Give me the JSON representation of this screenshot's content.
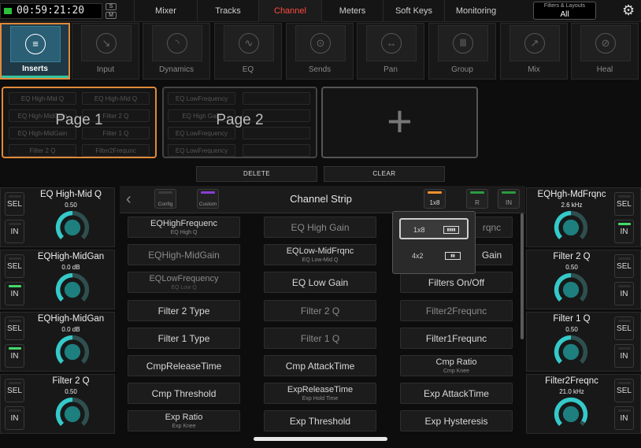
{
  "topbar": {
    "clock": "00:59:21:20",
    "small_buttons": [
      "S",
      "M"
    ],
    "tabs": [
      "Mixer",
      "Tracks",
      "Channel",
      "Meters",
      "Soft Keys",
      "Monitoring"
    ],
    "active_tab": "Channel",
    "filters_title": "Filters & Layouts",
    "filters_value": "All",
    "settings_icon": "gear-icon"
  },
  "categories": [
    {
      "label": "Inserts",
      "icon": "list-icon",
      "glyph": "≡"
    },
    {
      "label": "Input",
      "icon": "input-icon",
      "glyph": "↘"
    },
    {
      "label": "Dynamics",
      "icon": "dynamics-icon",
      "glyph": "◝"
    },
    {
      "label": "EQ",
      "icon": "eq-icon",
      "glyph": "∿"
    },
    {
      "label": "Sends",
      "icon": "sends-icon",
      "glyph": "⊙"
    },
    {
      "label": "Pan",
      "icon": "pan-icon",
      "glyph": "↔"
    },
    {
      "label": "Group",
      "icon": "group-icon",
      "glyph": "Ⅲ"
    },
    {
      "label": "Mix",
      "icon": "mix-icon",
      "glyph": "↗"
    },
    {
      "label": "Heal",
      "icon": "heal-icon",
      "glyph": "⊘"
    }
  ],
  "pages": [
    {
      "title": "Page 1",
      "cells": [
        "EQ High-Mid Q",
        "EQ High-Mid Q",
        "EQ High-MidGain",
        "Filter 2 Q",
        "EQ High-MidGain",
        "Filter 1 Q",
        "Filter 2 Q",
        "Filter2Frequnc"
      ]
    },
    {
      "title": "Page 2",
      "cells": [
        "EQ LowFrequency",
        "",
        "EQ High Gain",
        "",
        "EQ LowFrequency",
        "",
        "EQ LowFrequency",
        ""
      ]
    }
  ],
  "add_page_glyph": "+",
  "actions": {
    "delete": "DELETE",
    "clear": "CLEAR"
  },
  "strip_buttons": {
    "sel": "SEL",
    "in": "IN"
  },
  "left_strips": [
    {
      "name": "EQ High-Mid Q",
      "value": "0.50",
      "level": 0.5,
      "in_on": false
    },
    {
      "name": "EQHigh-MidGan",
      "value": "0.0 dB",
      "level": 0.5,
      "in_on": true
    },
    {
      "name": "EQHigh-MidGan",
      "value": "0.0 dB",
      "level": 0.5,
      "in_on": true
    },
    {
      "name": "Filter 2 Q",
      "value": "0.50",
      "level": 0.5,
      "in_on": false
    }
  ],
  "right_strips": [
    {
      "name": "EQHgh-MdFrqnc",
      "value": "2.6 kHz",
      "level": 0.5,
      "in_on": true
    },
    {
      "name": "Filter 2 Q",
      "value": "0.50",
      "level": 0.5,
      "in_on": false
    },
    {
      "name": "Filter 1 Q",
      "value": "0.50",
      "level": 0.5,
      "in_on": false
    },
    {
      "name": "Filter2Freqnc",
      "value": "21.0 kHz",
      "level": 0.95,
      "in_on": false
    }
  ],
  "channel_strip": {
    "title": "Channel Strip",
    "back_glyph": "‹",
    "icons": [
      {
        "label": "Config",
        "led": "#3a3a3a"
      },
      {
        "label": "Custom",
        "led": "#8a3fd1"
      },
      {
        "label": "1x8",
        "led": "#f0922b"
      },
      {
        "label": "R",
        "led": "#2c9b3f"
      },
      {
        "label": "IN",
        "led": "#2c9b3f"
      }
    ]
  },
  "params": {
    "col1": [
      {
        "main": "EQHighFrequenc",
        "sub": "EQ High Q",
        "dim": false
      },
      {
        "main": "EQHigh-MidGain",
        "sub": "",
        "dim": true
      },
      {
        "main": "EQLowFrequency",
        "sub": "EQ Low Q",
        "dim": true
      },
      {
        "main": "Filter 2 Type",
        "sub": "",
        "dim": false
      },
      {
        "main": "Filter 1 Type",
        "sub": "",
        "dim": false
      },
      {
        "main": "CmpReleaseTime",
        "sub": "",
        "dim": false
      },
      {
        "main": "Cmp Threshold",
        "sub": "",
        "dim": false
      },
      {
        "main": "Exp Ratio",
        "sub": "Exp Knee",
        "dim": false
      }
    ],
    "col2": [
      {
        "main": "EQ High Gain",
        "sub": "",
        "dim": true
      },
      {
        "main": "EQLow-MidFrqnc",
        "sub": "EQ Low-Mid Q",
        "dim": false
      },
      {
        "main": "EQ Low Gain",
        "sub": "",
        "dim": false
      },
      {
        "main": "Filter 2 Q",
        "sub": "",
        "dim": true
      },
      {
        "main": "Filter 1 Q",
        "sub": "",
        "dim": true
      },
      {
        "main": "Cmp AttackTime",
        "sub": "",
        "dim": false
      },
      {
        "main": "ExpReleaseTime",
        "sub": "Exp Hold Time",
        "dim": false
      },
      {
        "main": "Exp Threshold",
        "sub": "",
        "dim": false
      }
    ],
    "col3": [
      {
        "main": "rqnc",
        "sub": "",
        "dim": true
      },
      {
        "main": "Gain",
        "sub": "",
        "dim": false
      },
      {
        "main": "Filters On/Off",
        "sub": "",
        "dim": false
      },
      {
        "main": "Filter2Frequnc",
        "sub": "",
        "dim": true
      },
      {
        "main": "Filter1Frequnc",
        "sub": "",
        "dim": false
      },
      {
        "main": "Cmp Ratio",
        "sub": "Cmp Knee",
        "dim": false
      },
      {
        "main": "Exp AttackTime",
        "sub": "",
        "dim": false
      },
      {
        "main": "Exp Hysteresis",
        "sub": "",
        "dim": false
      }
    ]
  },
  "layout_popup": {
    "options": [
      "1x8",
      "4x2"
    ],
    "selected": "1x8"
  },
  "colors": {
    "accent": "#e08a3a",
    "knob": "#35c9c9",
    "knob_fill": "#1e7f7f",
    "active_tab": "#ff4a3d",
    "led_on": "#45d86b"
  }
}
